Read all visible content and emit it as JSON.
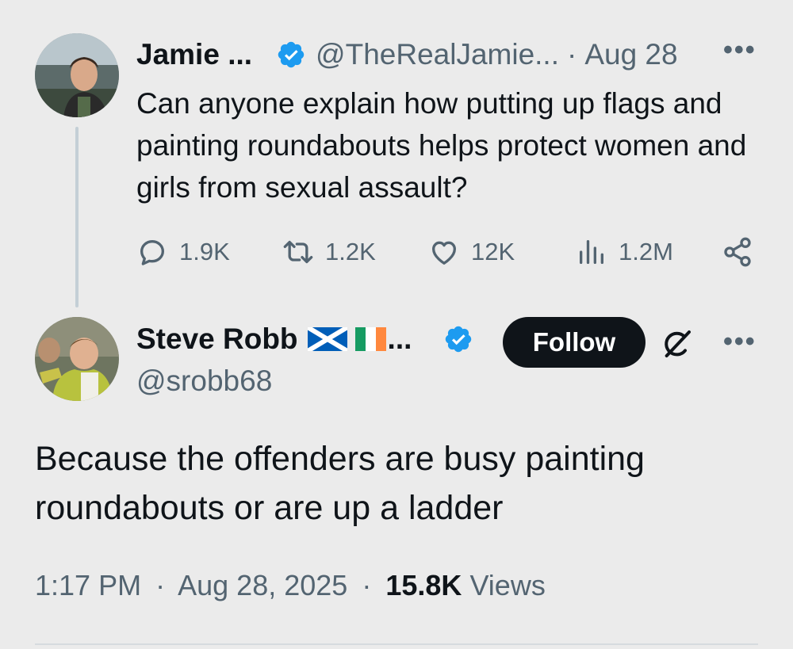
{
  "parent_tweet": {
    "author_name": "Jamie ...",
    "handle": "@TheRealJamie...",
    "separator": "·",
    "date": "Aug 28",
    "text": "Can anyone explain how putting up flags and painting roundabouts helps protect women and girls from sexual assault?",
    "more_label": "•••",
    "stats": {
      "replies": "1.9K",
      "retweets": "1.2K",
      "likes": "12K",
      "views": "1.2M"
    }
  },
  "reply_tweet": {
    "author_name": "Steve Robb",
    "name_ellipsis": "...",
    "handle": "@srobb68",
    "follow_label": "Follow",
    "more_label": "•••",
    "text": "Because the offenders are busy painting roundabouts or are up a ladder",
    "time": "1:17 PM",
    "date": "Aug 28, 2025",
    "separator": "·",
    "views_count": "15.8K",
    "views_label": "Views"
  },
  "icons": {
    "verified": "verified-badge-icon",
    "reply": "reply-icon",
    "retweet": "retweet-icon",
    "like": "heart-icon",
    "views": "views-bar-chart-icon",
    "share": "share-icon",
    "grok": "grok-icon",
    "flags": [
      "scotland-flag",
      "ireland-flag"
    ]
  },
  "colors": {
    "background": "#ebebeb",
    "text_primary": "#0f1419",
    "text_secondary": "#536471",
    "verified_blue": "#1d9bf0",
    "follow_button_bg": "#0f1419",
    "thread_line": "#c4cfd6"
  }
}
